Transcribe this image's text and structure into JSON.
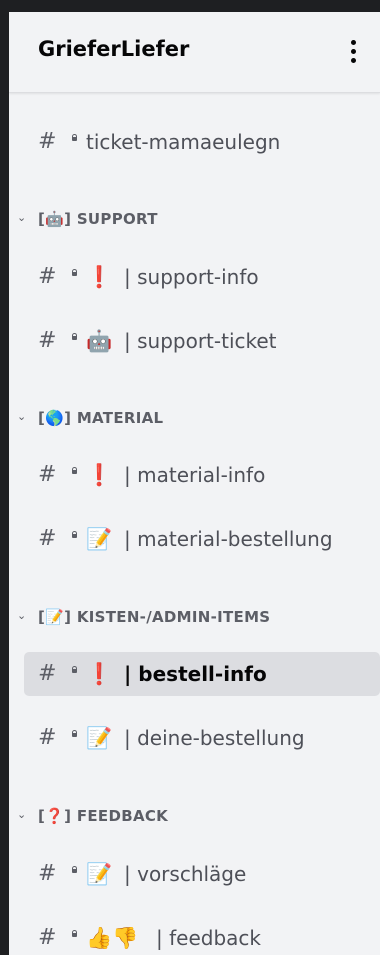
{
  "server": {
    "name": "GrieferLiefer",
    "menu_icon": "vertical-ellipsis-icon"
  },
  "channel_icon": "hashtag-lock-icon",
  "top_channel": {
    "label": "ticket-mamaeulegn"
  },
  "categories": [
    {
      "emoji": "🤖",
      "name": "SUPPORT",
      "channels": [
        {
          "emoji": "❗",
          "label": "support-info"
        },
        {
          "emoji": "🤖",
          "label": "support-ticket"
        }
      ]
    },
    {
      "emoji": "🌎",
      "name": "MATERIAL",
      "channels": [
        {
          "emoji": "❗",
          "label": "material-info"
        },
        {
          "emoji": "📝",
          "label": "material-bestellung"
        }
      ]
    },
    {
      "emoji": "📝",
      "name": "KISTEN-/ADMIN-ITEMS",
      "channels": [
        {
          "emoji": "❗",
          "label": "bestell-info",
          "active": true
        },
        {
          "emoji": "📝",
          "label": "deine-bestellung"
        }
      ]
    },
    {
      "emoji": "❓",
      "name": "FEEDBACK",
      "channels": [
        {
          "emoji": "📝",
          "label": "vorschläge"
        },
        {
          "emoji": "👍👎",
          "label": "feedback"
        }
      ]
    }
  ],
  "colors": {
    "panel_bg": "#f2f3f5",
    "active_bg": "#dcdde1",
    "outer_bg": "#1e1f22",
    "text_muted": "#5c5e66",
    "text_active": "#060607"
  }
}
